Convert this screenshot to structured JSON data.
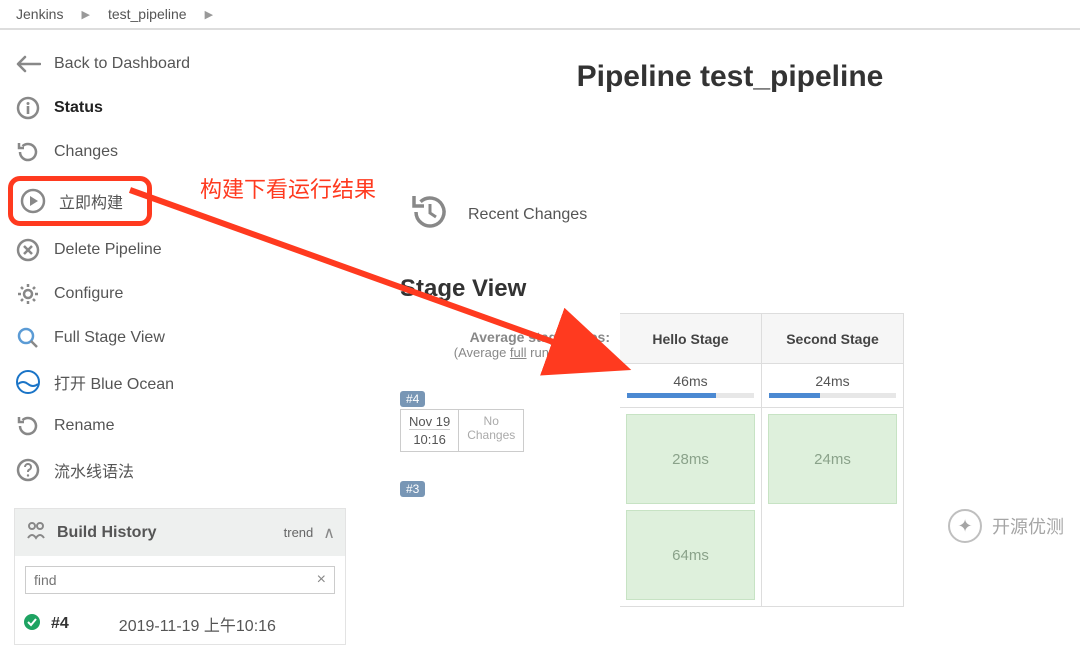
{
  "breadcrumb": {
    "items": [
      "Jenkins",
      "test_pipeline"
    ]
  },
  "sidebar": {
    "items": [
      {
        "label": "Back to Dashboard"
      },
      {
        "label": "Status",
        "active": true
      },
      {
        "label": "Changes"
      },
      {
        "label": "立即构建"
      },
      {
        "label": "Delete Pipeline"
      },
      {
        "label": "Configure"
      },
      {
        "label": "Full Stage View"
      },
      {
        "label": "打开 Blue Ocean"
      },
      {
        "label": "Rename"
      },
      {
        "label": "流水线语法"
      }
    ]
  },
  "history": {
    "title": "Build History",
    "trend_label": "trend",
    "search_placeholder": "find",
    "rows": [
      {
        "num": "#4",
        "date": "2019-11-19 上午10:16"
      }
    ]
  },
  "main": {
    "title": "Pipeline test_pipeline",
    "recent_changes": "Recent Changes",
    "stage_view_title": "Stage View",
    "avg_line1": "Average stage times:",
    "avg_line2_prefix": "(Average ",
    "avg_line2_full": "full",
    "avg_line2_suffix": " run time: ~1s)",
    "stages": [
      {
        "name": "Hello Stage",
        "avg": "46ms"
      },
      {
        "name": "Second Stage",
        "avg": "24ms"
      }
    ],
    "runs": [
      {
        "badge": "#4",
        "date": "Nov 19",
        "time": "10:16",
        "changes": "No Changes",
        "cells": [
          "28ms",
          "24ms"
        ]
      },
      {
        "badge": "#3",
        "date": "",
        "time": "",
        "changes": "",
        "cells": [
          "64ms",
          ""
        ]
      }
    ]
  },
  "annotation": "构建下看运行结果",
  "watermark": "开源优测"
}
